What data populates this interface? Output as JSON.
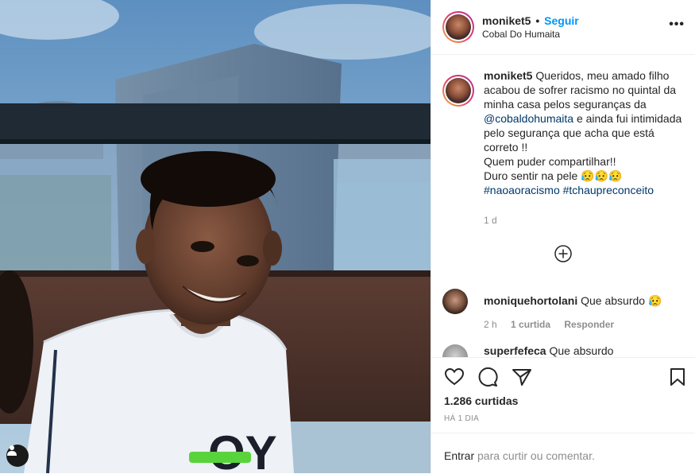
{
  "post": {
    "username": "moniket5",
    "separator": "•",
    "follow_label": "Seguir",
    "location": "Cobal Do Humaita",
    "more_label": "•••"
  },
  "caption": {
    "username": "moniket5",
    "line1": " Queridos, meu amado filho acabou de sofrer racismo no quintal da minha casa pelos seguranças da ",
    "mention": "@cobaldohumaita",
    "line2": " e ainda fui intimidada pelo segurança que acha que está correto !!",
    "line3": "Quem puder compartilhar!!",
    "line4": "Duro sentir na pele 😥😥😥",
    "hashtag1": "#naoaoracismo",
    "hashtag2": "#tchaupreconceito",
    "time": "1 d"
  },
  "comments": [
    {
      "username": "moniquehortolani",
      "text": "Que absurdo 😥",
      "time": "2 h",
      "likes": "1 curtida",
      "reply": "Responder"
    },
    {
      "username": "superfefeca",
      "text": "Que absurdo"
    }
  ],
  "stats": {
    "likes": "1.286 curtidas",
    "when": "HÁ 1 DIA"
  },
  "add_comment": {
    "login": "Entrar",
    "rest": " para curtir ou comentar."
  },
  "icons": {
    "heart": "heart-icon",
    "comment": "comment-icon",
    "share": "paper-plane-icon",
    "save": "bookmark-icon",
    "load_more": "plus-circle-icon",
    "user_tag": "user-icon"
  }
}
